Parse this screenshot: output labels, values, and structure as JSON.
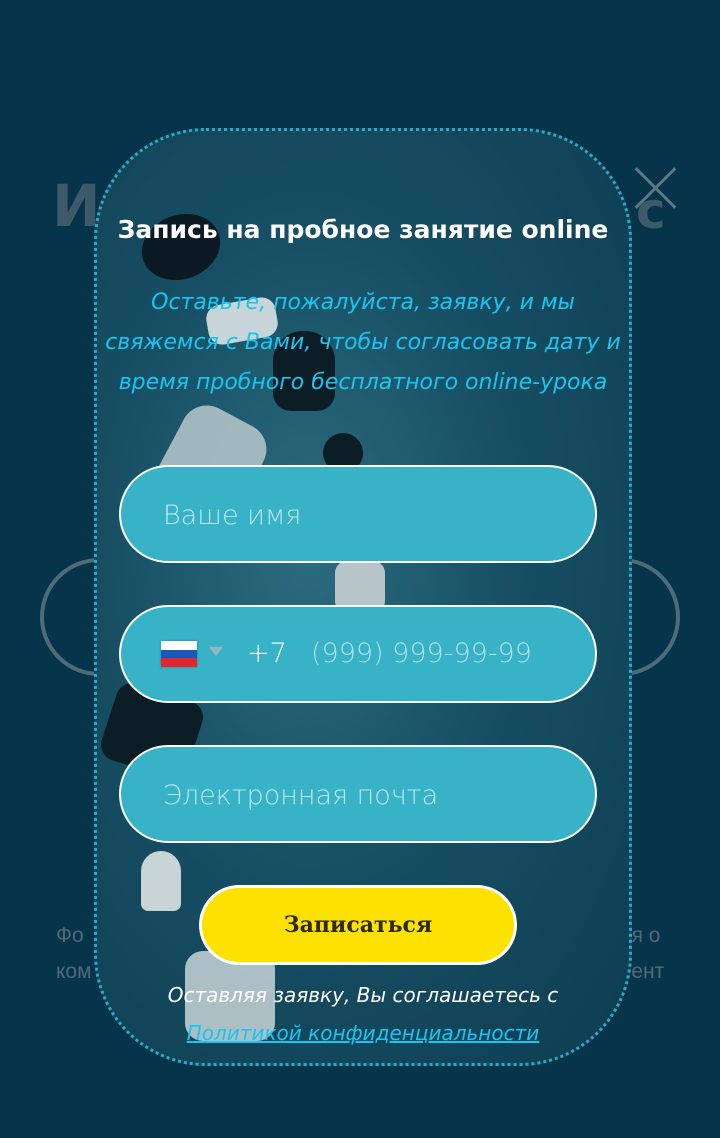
{
  "background": {
    "heading_left": "И",
    "heading_right": "с",
    "text_left_1": "Фо",
    "text_left_2": "ком",
    "text_right_1": "ня о",
    "text_right_2": "тент"
  },
  "modal": {
    "title": "Запись на пробное занятие online",
    "subtitle": "Оставьте, пожалуйста, заявку, и мы свяжемся с Вами, чтобы согласовать дату и время пробного бесплатного online-урока",
    "fields": {
      "name_placeholder": "Ваше имя",
      "phone_code": "+7",
      "phone_mask": "(999) 999-99-99",
      "email_placeholder": "Электронная почта"
    },
    "submit_label": "Записаться",
    "consent_text": "Оставляя заявку, Вы соглашаетесь с",
    "policy_link": "Политикой конфиденциальности"
  },
  "colors": {
    "page_bg": "#06344a",
    "field_bg": "#37b2c6",
    "accent_text": "#18c6f0",
    "button_bg": "#fde100"
  },
  "icons": {
    "flag": "russia-flag-icon",
    "dropdown": "caret-down-icon",
    "close": "close-icon"
  }
}
